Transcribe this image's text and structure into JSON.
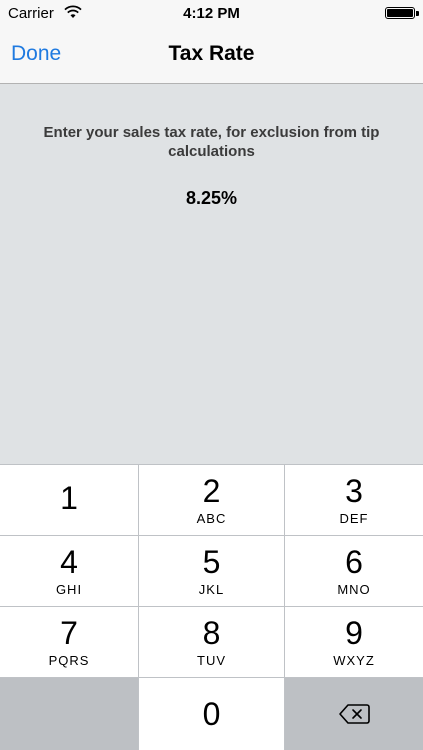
{
  "status": {
    "carrier": "Carrier",
    "time": "4:12 PM"
  },
  "nav": {
    "done_label": "Done",
    "title": "Tax Rate"
  },
  "content": {
    "prompt": "Enter your sales tax rate, for exclusion from tip calculations",
    "rate_value": "8.25%"
  },
  "keypad": {
    "keys": [
      {
        "number": "1",
        "letters": ""
      },
      {
        "number": "2",
        "letters": "ABC"
      },
      {
        "number": "3",
        "letters": "DEF"
      },
      {
        "number": "4",
        "letters": "GHI"
      },
      {
        "number": "5",
        "letters": "JKL"
      },
      {
        "number": "6",
        "letters": "MNO"
      },
      {
        "number": "7",
        "letters": "PQRS"
      },
      {
        "number": "8",
        "letters": "TUV"
      },
      {
        "number": "9",
        "letters": "WXYZ"
      },
      {
        "number": "0",
        "letters": ""
      }
    ],
    "delete_icon": "backspace-icon"
  },
  "colors": {
    "accent": "#1f7ae0",
    "content_bg": "#dfe2e4",
    "keypad_gray": "#bdc0c4"
  }
}
